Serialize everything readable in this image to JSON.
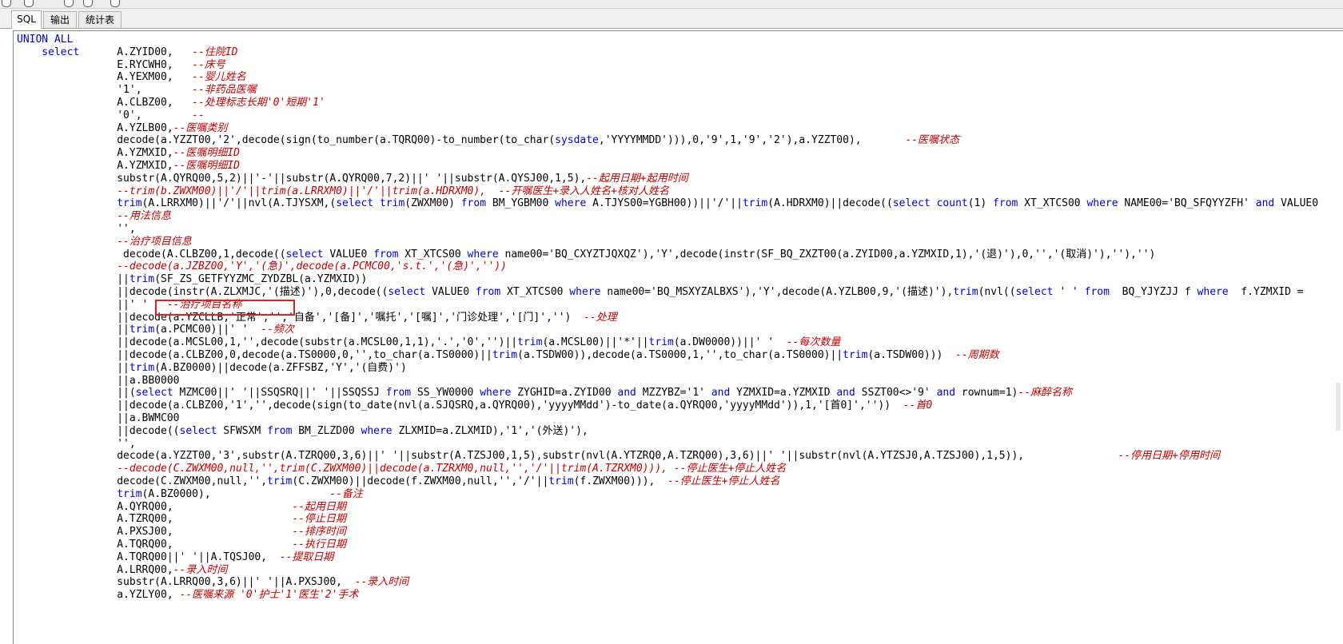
{
  "tabs": [
    {
      "label": "SQL",
      "active": true
    },
    {
      "label": "输出",
      "active": false
    },
    {
      "label": "统计表",
      "active": false
    }
  ],
  "editor": {
    "lines": [
      [
        {
          "t": "UNION ALL",
          "c": "kw"
        }
      ],
      [
        {
          "t": "    select",
          "c": "kw"
        },
        {
          "t": "      A.ZYID00,   "
        },
        {
          "t": "--住院ID",
          "c": "cm"
        }
      ],
      [
        {
          "t": "                E.RYCWH0,   "
        },
        {
          "t": "--床号",
          "c": "cm"
        }
      ],
      [
        {
          "t": "                A.YEXM00,   "
        },
        {
          "t": "--婴儿姓名",
          "c": "cm"
        }
      ],
      [
        {
          "t": "                '1',        "
        },
        {
          "t": "--非药品医嘱",
          "c": "cm"
        }
      ],
      [
        {
          "t": "                A.CLBZ00,   "
        },
        {
          "t": "--处理标志长期'0'短期'1'",
          "c": "cm"
        }
      ],
      [
        {
          "t": "                '0',        "
        },
        {
          "t": "--",
          "c": "cm"
        }
      ],
      [
        {
          "t": "                A.YZLB00,"
        },
        {
          "t": "--医嘱类别",
          "c": "cm"
        }
      ],
      [
        {
          "t": "                decode(a.YZZT00,'2',decode(sign(to_number(a.TQRQ00)-to_number(to_char("
        },
        {
          "t": "sysdate",
          "c": "kw"
        },
        {
          "t": ",'YYYYMMDD'))),0,'9',1,'9','2'),a.YZZT00),       "
        },
        {
          "t": "--医嘱状态",
          "c": "cm"
        }
      ],
      [
        {
          "t": "                A.YZMXID,"
        },
        {
          "t": "--医嘱明细ID",
          "c": "cm"
        }
      ],
      [
        {
          "t": "                A.YZMXID,"
        },
        {
          "t": "--医嘱明细ID",
          "c": "cm"
        }
      ],
      [
        {
          "t": "                substr(A.QYRQ00,5,2)||'-'||substr(A.QYRQ00,7,2)||' '||substr(A.QYSJ00,1,5),"
        },
        {
          "t": "--起用日期+起用时间",
          "c": "cm"
        }
      ],
      [
        {
          "t": "                "
        },
        {
          "t": "--trim(b.ZWXM00)||'/'||trim(a.LRRXM0)||'/'||trim(a.HDRXM0),  --开嘱医生+录入人姓名+核对人姓名",
          "c": "cm"
        }
      ],
      [
        {
          "t": "                "
        },
        {
          "t": "trim",
          "c": "kw"
        },
        {
          "t": "(A.LRRXM0)||'/'||nvl(A.TJYSXM,("
        },
        {
          "t": "select trim",
          "c": "kw"
        },
        {
          "t": "(ZWXM00) "
        },
        {
          "t": "from",
          "c": "kw"
        },
        {
          "t": " BM_YGBM00 "
        },
        {
          "t": "where",
          "c": "kw"
        },
        {
          "t": " A.TJYS00=YGBH00))||'/'||"
        },
        {
          "t": "trim",
          "c": "kw"
        },
        {
          "t": "(A.HDRXM0)||decode(("
        },
        {
          "t": "select count",
          "c": "kw"
        },
        {
          "t": "(1) "
        },
        {
          "t": "from",
          "c": "kw"
        },
        {
          "t": " XT_XTCS00 "
        },
        {
          "t": "where",
          "c": "kw"
        },
        {
          "t": " NAME00='BQ_SFQYYZFH' "
        },
        {
          "t": "and",
          "c": "kw"
        },
        {
          "t": " VALUE0"
        }
      ],
      [
        {
          "t": "                "
        },
        {
          "t": "--用法信息",
          "c": "cm"
        }
      ],
      [
        {
          "t": "                '',"
        }
      ],
      [
        {
          "t": "                "
        },
        {
          "t": "--治疗项目信息",
          "c": "cm"
        }
      ],
      [
        {
          "t": "                 decode(A.CLBZ00,1,decode(("
        },
        {
          "t": "select",
          "c": "kw"
        },
        {
          "t": " VALUE0 "
        },
        {
          "t": "from",
          "c": "kw"
        },
        {
          "t": " XT_XTCS00 "
        },
        {
          "t": "where",
          "c": "kw"
        },
        {
          "t": " name00='BQ_CXYZTJQXQZ'),'Y',decode(instr(SF_BQ_ZXZT00(a.ZYID00,a.YZMXID,1),'(退)'),0,'','(取消)'),''),'')"
        }
      ],
      [
        {
          "t": "                "
        },
        {
          "t": "--decode(a.JZBZ00,'Y','(急)',decode(a.PCMC00,'s.t.','(急)',''))",
          "c": "cm"
        }
      ],
      [
        {
          "t": "                ||"
        },
        {
          "t": "trim",
          "c": "kw"
        },
        {
          "t": "(SF_ZS_GETFYYZMC_ZYDZBL(a.YZMXID))"
        }
      ],
      [
        {
          "t": "                ||decode(instr(A.ZLXMJC,'(描述)'),0,decode(("
        },
        {
          "t": "select",
          "c": "kw"
        },
        {
          "t": " VALUE0 "
        },
        {
          "t": "from",
          "c": "kw"
        },
        {
          "t": " XT_XTCS00 "
        },
        {
          "t": "where",
          "c": "kw"
        },
        {
          "t": " name00='BQ_MSXYZALBXS'),'Y',decode(A.YZLB00,9,'(描述)'),"
        },
        {
          "t": "trim",
          "c": "kw"
        },
        {
          "t": "(nvl(("
        },
        {
          "t": "select",
          "c": "kw"
        },
        {
          "t": " ' ' "
        },
        {
          "t": "from",
          "c": "kw"
        },
        {
          "t": "  BQ_YJYZJJ f "
        },
        {
          "t": "where",
          "c": "kw"
        },
        {
          "t": "  f.YZMXID ="
        }
      ],
      [
        {
          "t": "                ||' '   "
        },
        {
          "t": "--治疗项目名称",
          "c": "cm"
        }
      ],
      [
        {
          "t": "                ||decode(a.YZCLLB,'正常','','自备','[备]','嘱托','[嘱]','门诊处理','[门]','')  "
        },
        {
          "t": "--处理",
          "c": "cm"
        }
      ],
      [
        {
          "t": "                ||"
        },
        {
          "t": "trim",
          "c": "kw"
        },
        {
          "t": "(a.PCMC00)||' '  "
        },
        {
          "t": "--频次",
          "c": "cm"
        }
      ],
      [
        {
          "t": "                ||decode(a.MCSL00,1,'',decode(substr(a.MCSL00,1,1),'.','0','')||"
        },
        {
          "t": "trim",
          "c": "kw"
        },
        {
          "t": "(a.MCSL00)||'*'||"
        },
        {
          "t": "trim",
          "c": "kw"
        },
        {
          "t": "(a.DW0000))||' '  "
        },
        {
          "t": "--每次数量",
          "c": "cm"
        }
      ],
      [
        {
          "t": "                ||decode(a.CLBZ00,0,decode(a.TS0000,0,'',to_char(a.TS0000)||"
        },
        {
          "t": "trim",
          "c": "kw"
        },
        {
          "t": "(a.TSDW00)),decode(a.TS0000,1,'',to_char(a.TS0000)||"
        },
        {
          "t": "trim",
          "c": "kw"
        },
        {
          "t": "(a.TSDW00)))  "
        },
        {
          "t": "--周期数",
          "c": "cm"
        }
      ],
      [
        {
          "t": "                ||"
        },
        {
          "t": "trim",
          "c": "kw"
        },
        {
          "t": "(A.BZ0000)||decode(a.ZFFSBZ,'Y','(自费)')"
        }
      ],
      [
        {
          "t": "                ||a.BB0000"
        }
      ],
      [
        {
          "t": "                ||("
        },
        {
          "t": "select",
          "c": "kw"
        },
        {
          "t": " MZMC00||' '||SSQSRQ||' '||SSQSSJ "
        },
        {
          "t": "from",
          "c": "kw"
        },
        {
          "t": " SS_YW0000 "
        },
        {
          "t": "where",
          "c": "kw"
        },
        {
          "t": " ZYGHID=a.ZYID00 "
        },
        {
          "t": "and",
          "c": "kw"
        },
        {
          "t": " MZZYBZ='1' "
        },
        {
          "t": "and",
          "c": "kw"
        },
        {
          "t": " YZMXID=a.YZMXID "
        },
        {
          "t": "and",
          "c": "kw"
        },
        {
          "t": " SSZT00<>'9' "
        },
        {
          "t": "and",
          "c": "kw"
        },
        {
          "t": " rownum=1)"
        },
        {
          "t": "--麻醉名称",
          "c": "cm"
        }
      ],
      [
        {
          "t": "                ||decode(a.CLBZ00,'1','',decode(sign(to_date(nvl(a.SJQSRQ,a.QYRQ00),'yyyyMMdd')-to_date(a.QYRQ00,'yyyyMMdd')),1,'[首0]',''))  "
        },
        {
          "t": "--首0",
          "c": "cm"
        }
      ],
      [
        {
          "t": "                ||a.BWMC00"
        }
      ],
      [
        {
          "t": "                ||decode(("
        },
        {
          "t": "select",
          "c": "kw"
        },
        {
          "t": " SFWSXM "
        },
        {
          "t": "from",
          "c": "kw"
        },
        {
          "t": " BM_ZLZD00 "
        },
        {
          "t": "where",
          "c": "kw"
        },
        {
          "t": " ZLXMID=a.ZLXMID),'1','(外送)'),"
        }
      ],
      [
        {
          "t": "                '',"
        }
      ],
      [
        {
          "t": "                decode(a.YZZT00,'3',substr(A.TZRQ00,3,6)||' '||substr(A.TZSJ00,1,5),substr(nvl(A.YTZRQ0,A.TZRQ00),3,6)||' '||substr(nvl(A.YTZSJ0,A.TZSJ00),1,5)),               "
        },
        {
          "t": "--停用日期+停用时间",
          "c": "cm"
        }
      ],
      [
        {
          "t": "                "
        },
        {
          "t": "--decode(C.ZWXM00,null,'',trim(C.ZWXM00)||decode(a.TZRXM0,null,'','/'||trim(A.TZRXM0))), --停止医生+停止人姓名",
          "c": "cm"
        }
      ],
      [
        {
          "t": "                decode(C.ZWXM00,null,'',"
        },
        {
          "t": "trim",
          "c": "kw"
        },
        {
          "t": "(C.ZWXM00)||decode(f.ZWXM00,null,'','/'||"
        },
        {
          "t": "trim",
          "c": "kw"
        },
        {
          "t": "(f.ZWXM00))),  "
        },
        {
          "t": "--停止医生+停止人姓名",
          "c": "cm"
        }
      ],
      [
        {
          "t": "                "
        },
        {
          "t": "trim",
          "c": "kw"
        },
        {
          "t": "(A.BZ0000),                   "
        },
        {
          "t": "--备注",
          "c": "cm"
        }
      ],
      [
        {
          "t": "                A.QYRQ00,                   "
        },
        {
          "t": "--起用日期",
          "c": "cm"
        }
      ],
      [
        {
          "t": "                A.TZRQ00,                   "
        },
        {
          "t": "--停止日期",
          "c": "cm"
        }
      ],
      [
        {
          "t": "                A.PXSJ00,                   "
        },
        {
          "t": "--排序时间",
          "c": "cm"
        }
      ],
      [
        {
          "t": "                A.TQRQ00,                   "
        },
        {
          "t": "--执行日期",
          "c": "cm"
        }
      ],
      [
        {
          "t": "                A.TQRQ00||' '||A.TQSJ00,  "
        },
        {
          "t": "--提取日期",
          "c": "cm"
        }
      ],
      [
        {
          "t": "                A.LRRQ00,"
        },
        {
          "t": "--录入时间",
          "c": "cm"
        }
      ],
      [
        {
          "t": "                substr(A.LRRQ00,3,6)||' '||A.PXSJ00,  "
        },
        {
          "t": "--录入时间",
          "c": "cm"
        }
      ],
      [
        {
          "t": "                a.YZLY00, "
        },
        {
          "t": "--医嘱来源 '0'护士'1'医生'2'手术",
          "c": "cm"
        }
      ]
    ]
  }
}
